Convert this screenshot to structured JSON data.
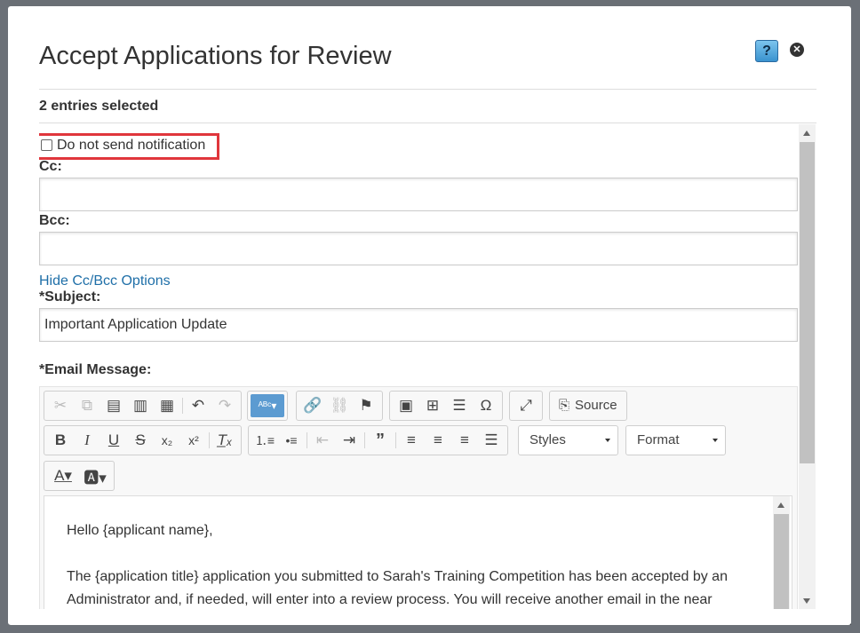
{
  "dialog": {
    "title": "Accept Applications for Review",
    "help_label": "?",
    "close_label": "✕"
  },
  "entries_selected": "2 entries selected",
  "notification": {
    "label": "Do not send notification",
    "checked": false
  },
  "cc": {
    "label": "Cc:",
    "value": ""
  },
  "bcc": {
    "label": "Bcc:",
    "value": ""
  },
  "hide_cc_link": "Hide Cc/Bcc Options",
  "subject": {
    "label": "*Subject:",
    "value": "Important Application Update"
  },
  "email_message": {
    "label": "*Email Message:",
    "toolbar": {
      "source_label": "Source",
      "styles_label": "Styles",
      "format_label": "Format"
    },
    "body": [
      "Hello {applicant name},",
      "The {application title} application you submitted to Sarah's Training Competition has been accepted by an Administrator and, if needed, will enter into a review process. You will receive another email in the near"
    ]
  },
  "colors": {
    "highlight_border": "#e0363c",
    "link": "#1f6fa8",
    "spellcheck_active": "#5c9bd1"
  }
}
